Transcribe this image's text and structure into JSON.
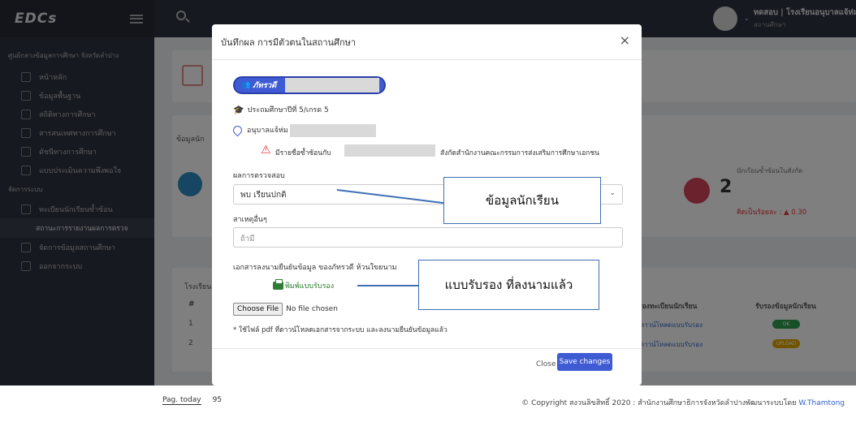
{
  "app": {
    "brand": "EDCs",
    "org": "ศูนย์กลางข้อมูลการศึกษา จังหวัดลำปาง",
    "user_name": "ทดสอบ | โรงเรียนอนุบาลแจ้ห่ม",
    "user_role": "สถานศึกษา"
  },
  "sidebar": {
    "items": [
      {
        "label": "หน้าหลัก"
      },
      {
        "label": "ข้อมูลพื้นฐาน"
      },
      {
        "label": "สถิติทางการศึกษา"
      },
      {
        "label": "สารสนเทศทางการศึกษา"
      },
      {
        "label": "ดัชนีทางการศึกษา"
      },
      {
        "label": "แบบประเมินความพึงพอใจ"
      }
    ],
    "section": "จัดการระบบ",
    "items2": [
      {
        "label": "ทะเบียนนักเรียนซ้ำซ้อน"
      }
    ],
    "sub_active": "สถานะการรายงานผลการตรวจ",
    "items3": [
      {
        "label": "จัดการข้อมูลสถานศึกษา"
      },
      {
        "label": "ออกจากระบบ"
      }
    ]
  },
  "background": {
    "card_label": "ข้อมูลนัก",
    "stat_label": "นักเรียนซ้ำซ้อนในสังกัด",
    "stat_value": "2",
    "stat_percent": "คิดเป็นร้อยละ : ▲ 0.30",
    "table_label": "โรงเรียน",
    "col_hash": "#",
    "col_reg": "รองทะเบียนนักเรียน",
    "col_cert": "รับรองข้อมูลนักเรียน",
    "rows": [
      {
        "num": "1",
        "link": "ดาวน์โหลดแบบรับรอง",
        "status": "OK"
      },
      {
        "num": "2",
        "link": "ดาวน์โหลดแบบรับรอง",
        "status": "UPLOAD"
      }
    ],
    "colors": {
      "ok": "#2e9e4f",
      "upload": "#e0a800",
      "stat_circle": "#d9455a",
      "info_circle": "#2d8cc4"
    }
  },
  "modal": {
    "title": "บันทึกผล การมีตัวตนในสถานศึกษา",
    "close_symbol": "×",
    "student_name": "ภัทรวดี",
    "grade": "ประถมศึกษาปีที่ 5/เกรด 5",
    "school": "อนุบาลแจ้ห่ม",
    "duplicate_prefix": "มีรายชื่อซ้ำซ้อนกับ",
    "duplicate_suffix": "สังกัดสำนักงานคณะกรรมการส่งเสริมการศึกษาเอกชน",
    "result_label": "ผลการตรวจสอบ",
    "result_value": "พบ เรียนปกติ",
    "other_label": "สาเหตุอื่นๆ",
    "other_placeholder": "ถ้ามี",
    "doc_label": "เอกสารลงนามยืนยันข้อมูล ของภัทรวดี ห้วนใขยนาม",
    "print_link": "พิมพ์แบบรับรอง",
    "choose_file": "Choose File",
    "no_file": "No file chosen",
    "note": "* ใช้ไฟล์ pdf ที่ดาวน์โหลดเอกสารจากระบบ และลงนามยืนยันข้อมูลแล้ว",
    "btn_close": "Close",
    "btn_save": "Save changes"
  },
  "annotations": {
    "student_info": "ข้อมูลนักเรียน",
    "signed_form": "แบบรับรอง ที่ลงนามแล้ว"
  },
  "footer": {
    "pag_label": "Pag. today",
    "pag_value": "95",
    "copyright": "© Copyright สงวนลิขสิทธิ์ 2020 : สำนักงานศึกษาธิการจังหวัดลำปางพัฒนาระบบโดย ",
    "author": "W.Thamtong"
  }
}
